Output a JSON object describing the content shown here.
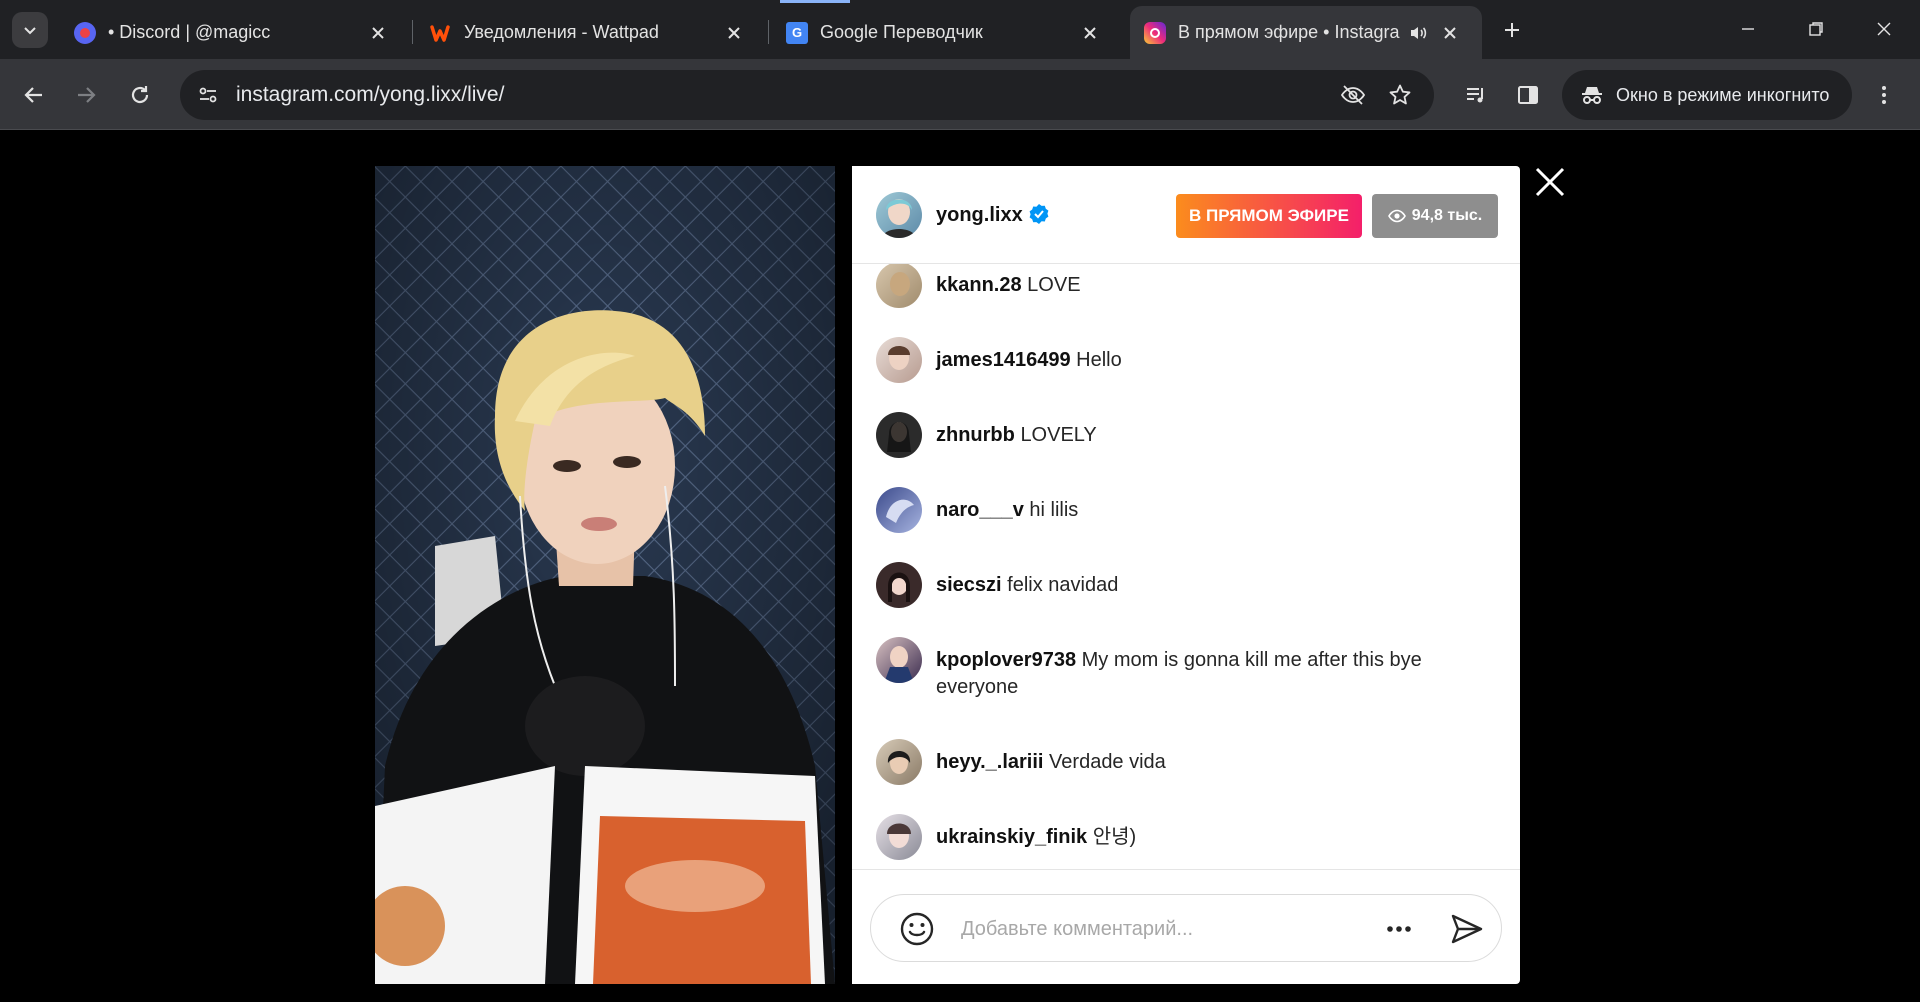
{
  "tabs": [
    {
      "title": "• Discord | @magicc",
      "favicon": "discord-icon",
      "active": false
    },
    {
      "title": "Уведомления - Wattpad",
      "favicon": "wattpad-icon",
      "active": false
    },
    {
      "title": "Google Переводчик",
      "favicon": "google-translate-icon",
      "active": false
    },
    {
      "title": "В прямом эфире • Instagram",
      "favicon": "instagram-icon",
      "active": true
    }
  ],
  "toolbar": {
    "url": "instagram.com/yong.lixx/live/",
    "incognito_label": "Окно в режиме инкогнито"
  },
  "live": {
    "host": {
      "username": "yong.lixx",
      "verified": true
    },
    "badge": "В ПРЯМОМ ЭФИРЕ",
    "viewers": "94,8 тыс.",
    "comments": [
      {
        "user": "kkann.28",
        "text": "LOVE"
      },
      {
        "user": "james1416499",
        "text": "Hello"
      },
      {
        "user": "zhnurbb",
        "text": "LOVELY"
      },
      {
        "user": "naro___v",
        "text": "hi lilis"
      },
      {
        "user": "siecszi",
        "text": "felix navidad"
      },
      {
        "user": "kpoplover9738",
        "text": "My mom is gonna kill me after this bye everyone"
      },
      {
        "user": "heyy._.lariii",
        "text": "Verdade vida"
      },
      {
        "user": "ukrainskiy_finik",
        "text": "안녕)"
      }
    ],
    "comment_placeholder": "Добавьте комментарий..."
  },
  "colors": {
    "live_gradient_start": "#fb8c1d",
    "live_gradient_end": "#f41f6a",
    "verified_blue": "#0095f6"
  }
}
